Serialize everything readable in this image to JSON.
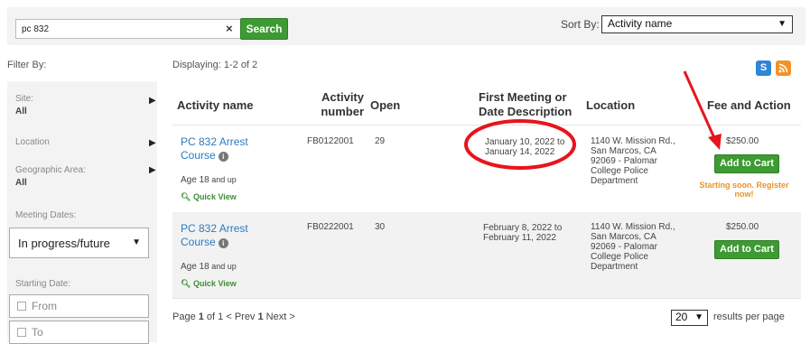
{
  "search": {
    "value": "pc 832",
    "clear_icon": "×",
    "button_label": "Search"
  },
  "sort": {
    "label": "Sort By:",
    "selected": "Activity name"
  },
  "filter_by_label": "Filter By:",
  "displaying": "Displaying: 1-2 of 2",
  "icons": {
    "share": "S",
    "rss": "rss"
  },
  "sidebar": {
    "site_label": "Site:",
    "site_value": "All",
    "location_label": "Location",
    "geo_label": "Geographic Area:",
    "geo_value": "All",
    "meeting_dates_label": "Meeting Dates:",
    "meeting_dates_selected": "In progress/future",
    "starting_date_label": "Starting Date:",
    "from_placeholder": "From",
    "to_placeholder": "To"
  },
  "columns": {
    "activity_name": "Activity name",
    "activity_number_1": "Activity",
    "activity_number_2": "number",
    "open": "Open",
    "first_meeting_1": "First Meeting or",
    "first_meeting_2": "Date Description",
    "location": "Location",
    "fee_action": "Fee and Action"
  },
  "rows": [
    {
      "name_1": "PC 832 Arrest",
      "name_2": "Course",
      "age_prefix": "Age ",
      "age_num": "18",
      "age_suffix": " and up",
      "quick_view": "Quick View",
      "number": "FB0122001",
      "open": "29",
      "date_1": "January 10, 2022 to",
      "date_2": "January 14, 2022",
      "loc_1": "1140 W. Mission Rd.,",
      "loc_2": "San Marcos, CA",
      "loc_3": "92069 - Palomar",
      "loc_4": "College Police",
      "loc_5": "Department",
      "fee": "$250.00",
      "action": "Add to Cart",
      "note_1": "Starting soon. Register",
      "note_2": "now!"
    },
    {
      "name_1": "PC 832 Arrest",
      "name_2": "Course",
      "age_prefix": "Age ",
      "age_num": "18",
      "age_suffix": " and up",
      "quick_view": "Quick View",
      "number": "FB0222001",
      "open": "30",
      "date_1": "February 8, 2022 to",
      "date_2": "February 11, 2022",
      "loc_1": "1140 W. Mission Rd.,",
      "loc_2": "San Marcos, CA",
      "loc_3": "92069 - Palomar",
      "loc_4": "College Police",
      "loc_5": "Department",
      "fee": "$250.00",
      "action": "Add to Cart"
    }
  ],
  "pager": {
    "page_word": "Page ",
    "page_num": "1",
    "of_text": " of 1 < Prev ",
    "current": "1",
    "next": " Next >"
  },
  "per_page": {
    "value": "20",
    "label": "results per page"
  },
  "annotation_color": "#e8141c"
}
